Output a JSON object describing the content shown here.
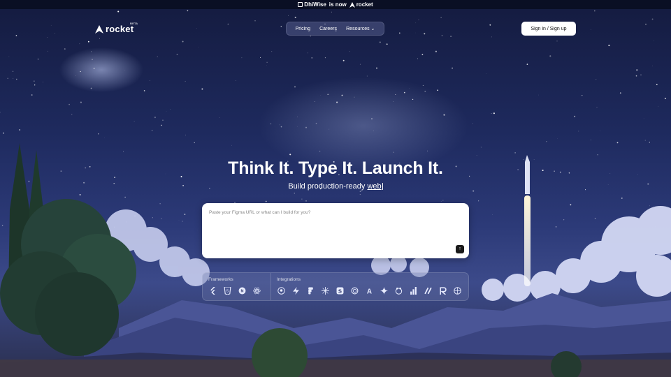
{
  "announcement": {
    "from_brand": "DhiWise",
    "connector": "is now",
    "to_brand": "rocket"
  },
  "header": {
    "logo_text": "rocket",
    "logo_badge": "BETA",
    "nav": [
      {
        "label": "Pricing"
      },
      {
        "label": "Careers"
      },
      {
        "label": "Resources"
      }
    ],
    "signin_label": "Sign in / Sign up"
  },
  "hero": {
    "title": "Think It. Type It. Launch It.",
    "subtitle_prefix": "Build production-ready",
    "subtitle_word": "web"
  },
  "prompt": {
    "placeholder": "Paste your Figma URL or what can I build for you?",
    "send_icon": "arrow-up-icon"
  },
  "tech": {
    "frameworks_label": "Frameworks",
    "frameworks": [
      "flutter-icon",
      "html5-icon",
      "nextjs-icon",
      "react-icon"
    ],
    "integrations_label": "Integrations",
    "integrations": [
      "github-icon",
      "supabase-icon",
      "figma-icon",
      "perplexity-icon",
      "stripe-icon",
      "openai-icon",
      "anthropic-icon",
      "gemini-icon",
      "mailchimp-icon",
      "analytics-icon",
      "netlify-icon",
      "resend-icon",
      "dribbble-icon"
    ]
  },
  "colors": {
    "sky_top": "#141b3f",
    "sky_mid": "#2c3a78",
    "announce_bg": "#0a0f24",
    "signin_bg": "#ffffff"
  }
}
